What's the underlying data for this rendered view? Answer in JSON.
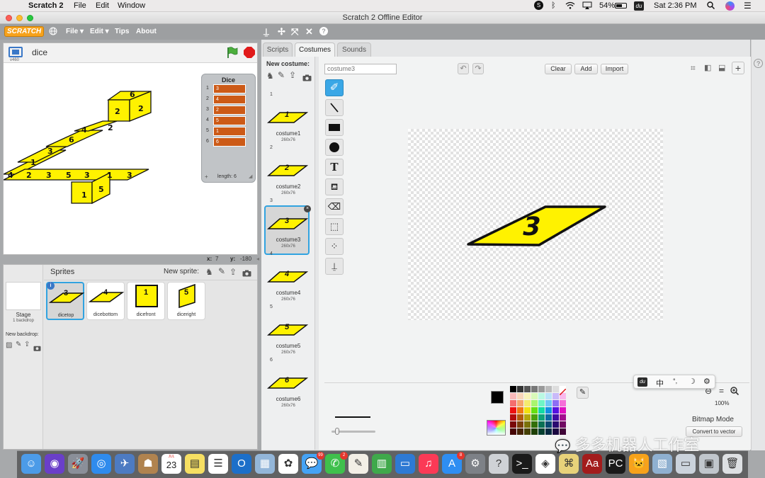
{
  "menubar": {
    "app": "Scratch 2",
    "menus": [
      "File",
      "Edit",
      "Window"
    ],
    "battery": "54%",
    "clock": "Sat 2:36 PM",
    "du_label": "du"
  },
  "window": {
    "title": "Scratch 2 Offline Editor"
  },
  "scratch_menu": {
    "logo": "SCRATCH",
    "file": "File ▾",
    "edit": "Edit ▾",
    "tips": "Tips",
    "about": "About"
  },
  "stage": {
    "name": "dice",
    "version": "v460",
    "x_label": "x:",
    "x_value": "7",
    "y_label": "y:",
    "y_value": "-180"
  },
  "list_monitor": {
    "title": "Dice",
    "items": [
      {
        "index": "1",
        "value": "3"
      },
      {
        "index": "2",
        "value": "4"
      },
      {
        "index": "3",
        "value": "2"
      },
      {
        "index": "4",
        "value": "5"
      },
      {
        "index": "5",
        "value": "1"
      },
      {
        "index": "6",
        "value": "6"
      }
    ],
    "add": "+",
    "length": "length: 6"
  },
  "sprite_panel": {
    "title": "Sprites",
    "new_sprite_label": "New sprite:",
    "stage_label": "Stage",
    "stage_backdrops": "1 backdrop",
    "new_backdrop_label": "New backdrop:",
    "sprites": [
      {
        "name": "dicetop",
        "glyph": "3"
      },
      {
        "name": "dicebottom",
        "glyph": "4"
      },
      {
        "name": "dicefront",
        "glyph": "1"
      },
      {
        "name": "diceright",
        "glyph": "5"
      }
    ]
  },
  "tabs": {
    "scripts": "Scripts",
    "costumes": "Costumes",
    "sounds": "Sounds"
  },
  "costumes": {
    "new_costume_label": "New costume:",
    "items": [
      {
        "num": "1",
        "name": "costume1",
        "size": "260x76",
        "glyph": "1"
      },
      {
        "num": "2",
        "name": "costume2",
        "size": "260x76",
        "glyph": "2"
      },
      {
        "num": "3",
        "name": "costume3",
        "size": "260x76",
        "glyph": "3"
      },
      {
        "num": "4",
        "name": "costume4",
        "size": "260x76",
        "glyph": "4"
      },
      {
        "num": "5",
        "name": "costume5",
        "size": "260x76",
        "glyph": "5"
      },
      {
        "num": "6",
        "name": "costume6",
        "size": "260x76",
        "glyph": "6"
      }
    ],
    "selected_index": 2
  },
  "paint_editor": {
    "costume_name": "costume3",
    "clear": "Clear",
    "add": "Add",
    "import": "Import",
    "canvas_glyph": "3",
    "zoom": "100%",
    "mode": "Bitmap Mode",
    "convert": "Convert to vector",
    "ime": [
      "du",
      "中",
      "°,",
      "☽",
      "⚙"
    ],
    "colors": {
      "brand_orange": "#f7a21b",
      "dice_yellow": "#fff200",
      "list_item": "#cc5a17",
      "selection": "#31a3e0"
    }
  },
  "watermark": "多多机器人工作室",
  "dock": {
    "calendar_month": "JUL",
    "calendar_day": "23",
    "badges": [
      "99",
      "2",
      "8"
    ]
  }
}
